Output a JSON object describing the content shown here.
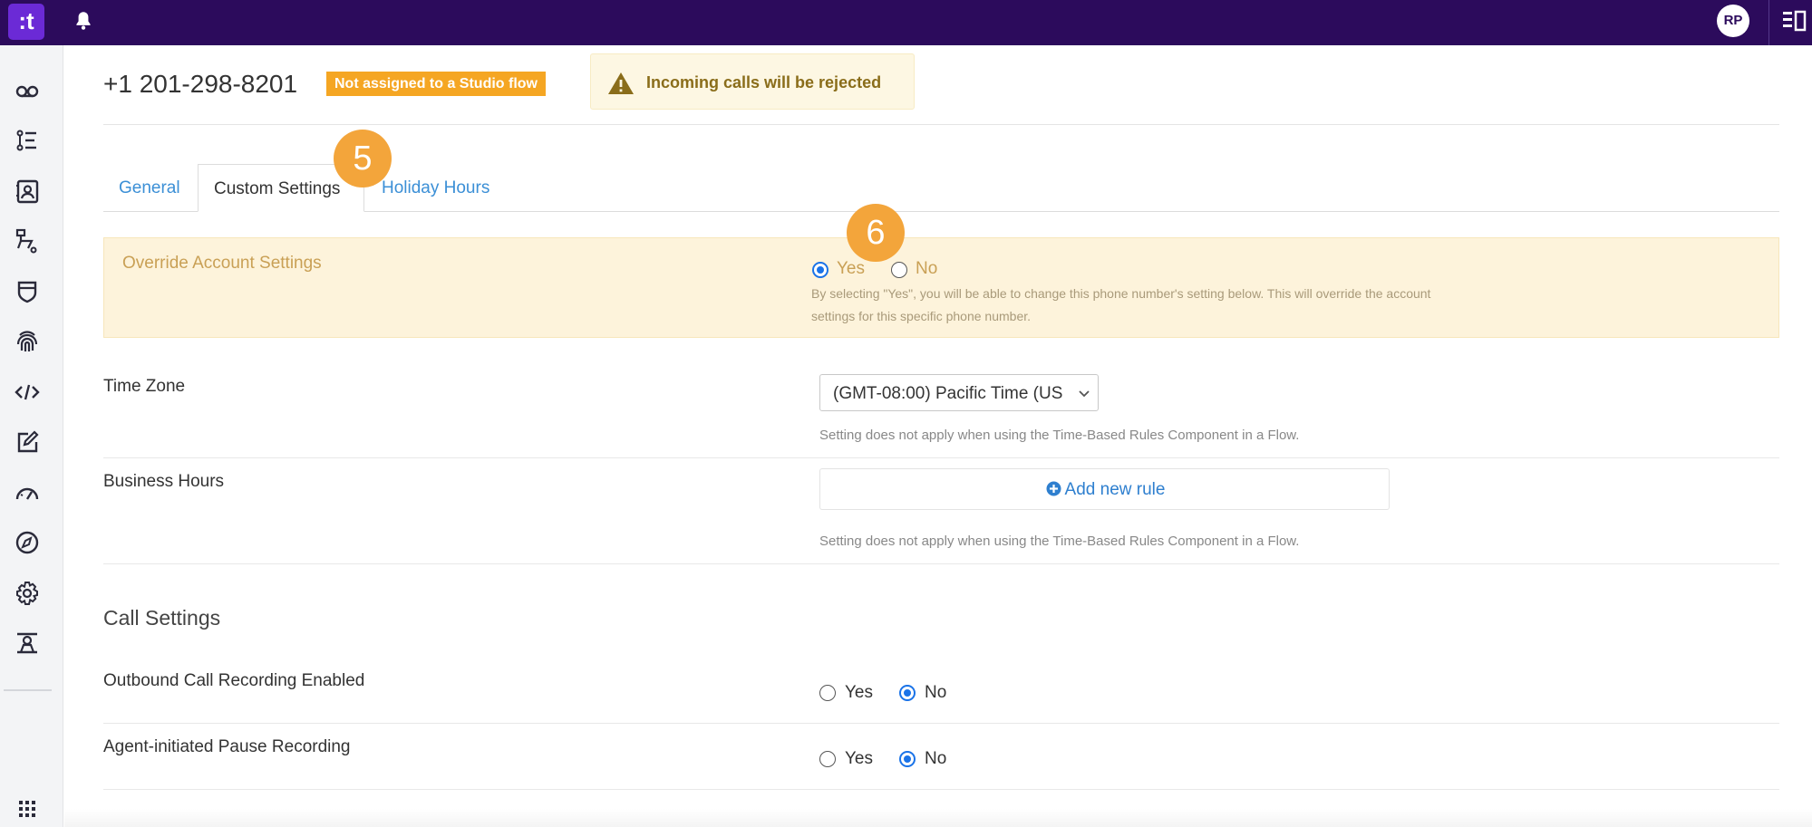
{
  "topbar": {
    "logo_text": ":t",
    "user_initials": "RP"
  },
  "sidebar": {
    "icons": [
      "voicemail-icon",
      "list-icon",
      "contacts-icon",
      "flow-icon",
      "shield-icon",
      "fingerprint-icon",
      "code-icon",
      "edit-icon",
      "dashboard-icon",
      "compass-icon",
      "gear-icon",
      "agent-icon",
      "apps-grid-icon"
    ]
  },
  "header": {
    "phone_number": "+1 201-298-8201",
    "studio_badge": "Not assigned to a Studio flow",
    "alert_text": "Incoming calls will be rejected"
  },
  "tabs": [
    {
      "label": "General",
      "active": false
    },
    {
      "label": "Custom Settings",
      "active": true
    },
    {
      "label": "Holiday Hours",
      "active": false
    }
  ],
  "steps": {
    "tab_step": "5",
    "override_step": "6"
  },
  "override": {
    "label": "Override Account Settings",
    "yes_label": "Yes",
    "no_label": "No",
    "selected": "Yes",
    "help_text": "By selecting \"Yes\", you will be able to change this phone number's setting below. This will override the account settings for this specific phone number."
  },
  "time_zone": {
    "label": "Time Zone",
    "value": "(GMT-08:00) Pacific Time (US",
    "help": "Setting does not apply when using the Time-Based Rules Component in a Flow."
  },
  "business_hours": {
    "label": "Business Hours",
    "add_rule_label": "Add new rule",
    "help": "Setting does not apply when using the Time-Based Rules Component in a Flow."
  },
  "call_settings": {
    "title": "Call Settings",
    "rows": [
      {
        "label": "Outbound Call Recording Enabled",
        "yes_label": "Yes",
        "no_label": "No",
        "selected": "No"
      },
      {
        "label": "Agent-initiated Pause Recording",
        "yes_label": "Yes",
        "no_label": "No",
        "selected": "No"
      }
    ]
  },
  "colors": {
    "topbar": "#2c0b5c",
    "accent_blue": "#1a73e8",
    "badge_orange": "#f5a623",
    "step_orange": "#f3a53b"
  }
}
